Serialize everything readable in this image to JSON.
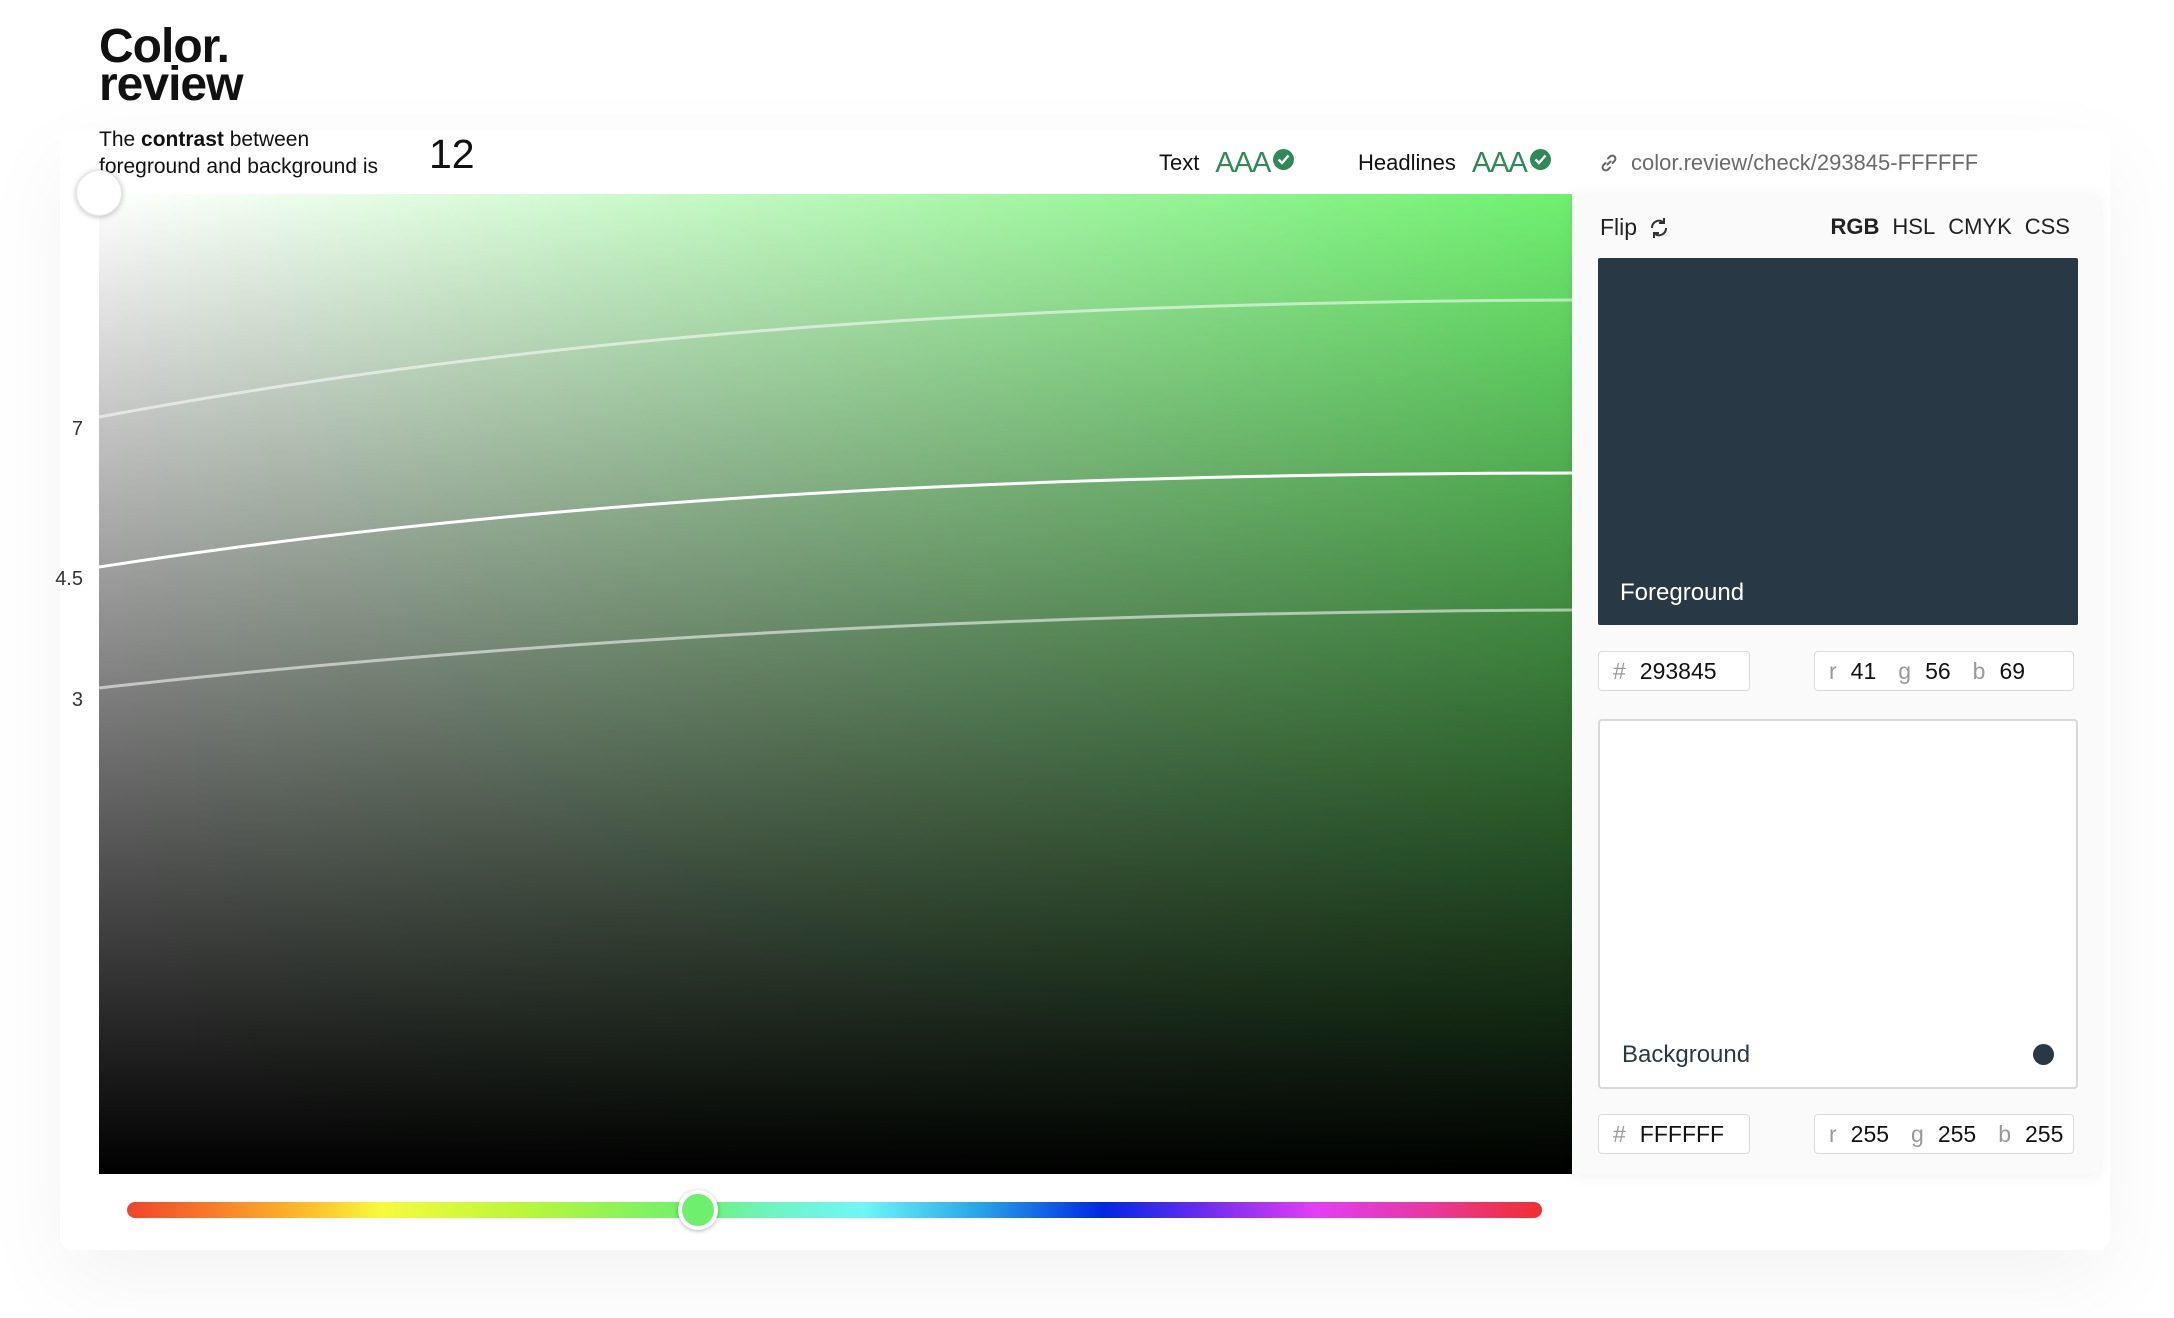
{
  "logo": {
    "line1": "Color.",
    "line2": "review"
  },
  "contrast": {
    "text_pre": "The ",
    "text_bold": "contrast",
    "text_post": " between",
    "text_line2": "foreground and background is",
    "value": "12"
  },
  "ratings": [
    {
      "label": "Text",
      "grade": "AAA"
    },
    {
      "label": "Headlines",
      "grade": "AAA"
    }
  ],
  "share_url": "color.review/check/293845-FFFFFF",
  "y_axis_labels": [
    "7",
    "4.5",
    "3"
  ],
  "panel": {
    "flip_label": "Flip",
    "modes": [
      "RGB",
      "HSL",
      "CMYK",
      "CSS"
    ],
    "active_mode": "RGB",
    "foreground": {
      "label": "Foreground",
      "hex": "293845",
      "r": "41",
      "g": "56",
      "b": "69",
      "color": "#293845"
    },
    "background": {
      "label": "Background",
      "hex": "FFFFFF",
      "r": "255",
      "g": "255",
      "b": "255",
      "color": "#FFFFFF"
    },
    "channel_labels": {
      "hash": "#",
      "r": "r",
      "g": "g",
      "b": "b"
    }
  },
  "hue": {
    "color": "#6ef06e",
    "position": 0.405
  },
  "accent": "#2e8b57"
}
